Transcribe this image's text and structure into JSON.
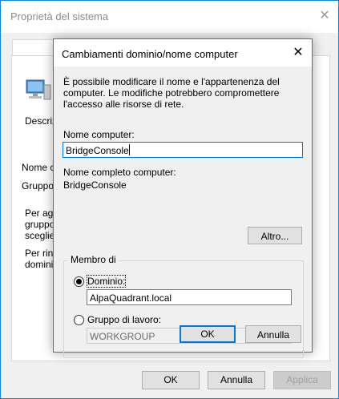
{
  "background_window": {
    "title": "Proprietà del sistema",
    "tab_label": "No",
    "text_descr": "Descrizi",
    "text_nome": "Nome co",
    "text_gruppo": "Gruppo c",
    "text_per_aggi_1": "Per aggi",
    "text_per_aggi_2": "gruppo c",
    "text_per_aggi_3": "sceglier",
    "text_per_rinom_1": "Per rinor",
    "text_per_rinom_2": "dominio",
    "ok_label": "OK",
    "cancel_label": "Annulla",
    "apply_label": "Applica"
  },
  "dialog": {
    "title": "Cambiamenti dominio/nome computer",
    "intro": "È possibile modificare il nome e l'appartenenza del computer. Le modifiche potrebbero compromettere l'accesso alle risorse di rete.",
    "computer_name_label": "Nome computer:",
    "computer_name_value": "BridgeConsole",
    "full_name_label": "Nome completo computer:",
    "full_name_value": "BridgeConsole",
    "more_button": "Altro...",
    "member_of_label": "Membro di",
    "domain_radio_label": "Dominio:",
    "domain_value": "AlpaQuadrant.local",
    "domain_selected": true,
    "workgroup_radio_label": "Gruppo di lavoro:",
    "workgroup_value": "WORKGROUP",
    "ok_button": "OK",
    "cancel_button": "Annulla"
  },
  "colors": {
    "accent": "#0078d7",
    "window_border": "#1883d7",
    "dialog_background": "#f0f0f0"
  }
}
